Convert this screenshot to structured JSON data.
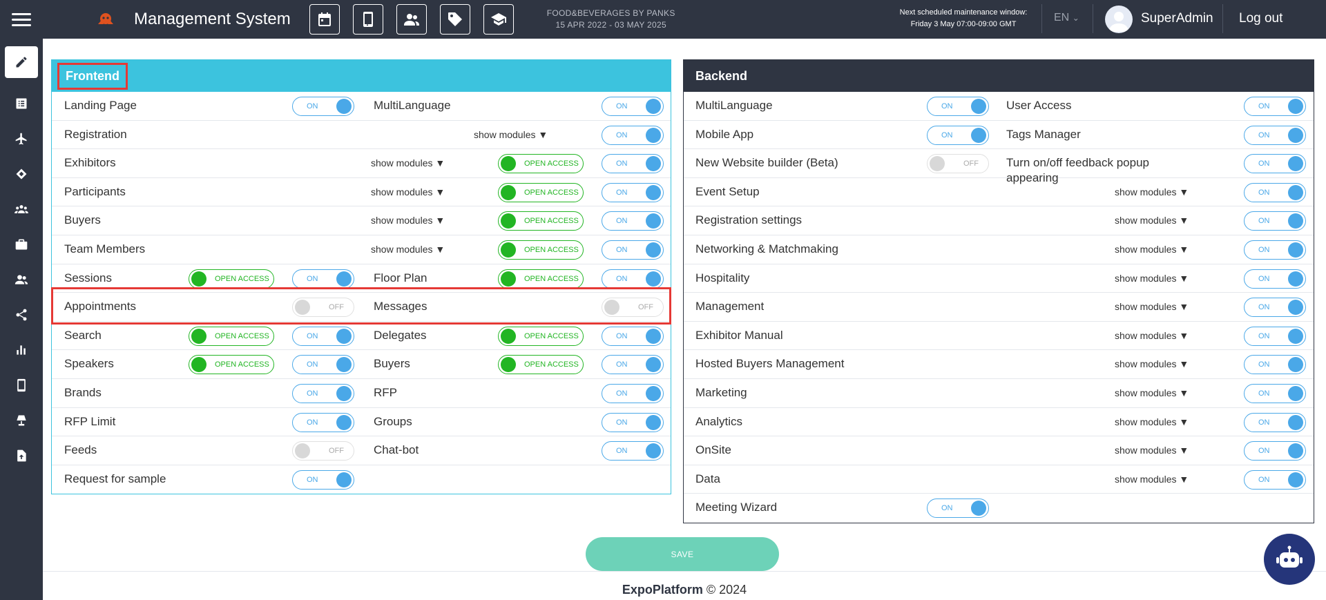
{
  "header": {
    "title": "Management System",
    "event_name": "FOOD&BEVERAGES BY PANKS",
    "event_dates": "15 APR 2022 - 03 MAY 2025",
    "maintenance_line1": "Next scheduled maintenance window:",
    "maintenance_line2": "Friday 3 May 07:00-09:00 GMT",
    "language": "EN",
    "username": "SuperAdmin",
    "logout": "Log out",
    "toolbar_icons": [
      "calendar-icon",
      "mobile-icon",
      "users-icon",
      "tag-icon",
      "graduation-cap-icon"
    ]
  },
  "sidebar": {
    "icons": [
      "pencil-icon",
      "list-icon",
      "plane-icon",
      "handshake-icon",
      "group-icon",
      "briefcase-icon",
      "users-icon",
      "share-icon",
      "bar-chart-icon",
      "mobile-icon",
      "lamp-icon",
      "file-upload-icon"
    ],
    "active_index": 0
  },
  "frontend": {
    "title": "Frontend",
    "rows": [
      {
        "left": {
          "label": "Landing Page",
          "toggle": "ON"
        },
        "right": {
          "label": "MultiLanguage",
          "toggle": "ON"
        }
      },
      {
        "left": {
          "label": "Registration"
        },
        "right": {
          "show_modules": "show modules ▼",
          "toggle": "ON"
        }
      },
      {
        "left": {
          "label": "Exhibitors",
          "show_modules": "show modules ▼"
        },
        "right": {
          "open_access": "OPEN ACCESS",
          "toggle": "ON"
        }
      },
      {
        "left": {
          "label": "Participants",
          "show_modules": "show modules ▼"
        },
        "right": {
          "open_access": "OPEN ACCESS",
          "toggle": "ON"
        }
      },
      {
        "left": {
          "label": "Buyers",
          "show_modules": "show modules ▼"
        },
        "right": {
          "open_access": "OPEN ACCESS",
          "toggle": "ON"
        }
      },
      {
        "left": {
          "label": "Team Members",
          "show_modules": "show modules ▼"
        },
        "right": {
          "open_access": "OPEN ACCESS",
          "toggle": "ON"
        }
      },
      {
        "left": {
          "label": "Sessions",
          "open_access": "OPEN ACCESS",
          "toggle": "ON"
        },
        "right": {
          "label": "Floor Plan",
          "open_access": "OPEN ACCESS",
          "toggle": "ON"
        }
      },
      {
        "left": {
          "label": "Appointments",
          "toggle": "OFF"
        },
        "right": {
          "label": "Messages",
          "toggle": "OFF"
        }
      },
      {
        "left": {
          "label": "Search",
          "open_access": "OPEN ACCESS",
          "toggle": "ON"
        },
        "right": {
          "label": "Delegates",
          "open_access": "OPEN ACCESS",
          "toggle": "ON"
        }
      },
      {
        "left": {
          "label": "Speakers",
          "open_access": "OPEN ACCESS",
          "toggle": "ON"
        },
        "right": {
          "label": "Buyers",
          "open_access": "OPEN ACCESS",
          "toggle": "ON"
        }
      },
      {
        "left": {
          "label": "Brands",
          "toggle": "ON"
        },
        "right": {
          "label": "RFP",
          "toggle": "ON"
        }
      },
      {
        "left": {
          "label": "RFP Limit",
          "toggle": "ON"
        },
        "right": {
          "label": "Groups",
          "toggle": "ON"
        }
      },
      {
        "left": {
          "label": "Feeds",
          "toggle": "OFF"
        },
        "right": {
          "label": "Chat-bot",
          "toggle": "ON"
        }
      },
      {
        "left": {
          "label": "Request for sample",
          "toggle": "ON"
        },
        "right": {}
      }
    ]
  },
  "backend": {
    "title": "Backend",
    "rows": [
      {
        "left": {
          "label": "MultiLanguage",
          "toggle": "ON"
        },
        "right": {
          "label": "User Access",
          "toggle": "ON"
        }
      },
      {
        "left": {
          "label": "Mobile App",
          "toggle": "ON"
        },
        "right": {
          "label": "Tags Manager",
          "toggle": "ON"
        }
      },
      {
        "left": {
          "label": "New Website builder (Beta)",
          "toggle": "OFF"
        },
        "right": {
          "label": "Turn on/off feedback popup appearing",
          "toggle": "ON"
        }
      },
      {
        "left": {
          "label": "Event Setup"
        },
        "right": {
          "show_modules": "show modules ▼",
          "toggle": "ON"
        }
      },
      {
        "left": {
          "label": "Registration settings"
        },
        "right": {
          "show_modules": "show modules ▼",
          "toggle": "ON"
        }
      },
      {
        "left": {
          "label": "Networking & Matchmaking"
        },
        "right": {
          "show_modules": "show modules ▼",
          "toggle": "ON"
        }
      },
      {
        "left": {
          "label": "Hospitality"
        },
        "right": {
          "show_modules": "show modules ▼",
          "toggle": "ON"
        }
      },
      {
        "left": {
          "label": "Management"
        },
        "right": {
          "show_modules": "show modules ▼",
          "toggle": "ON"
        }
      },
      {
        "left": {
          "label": "Exhibitor Manual"
        },
        "right": {
          "show_modules": "show modules ▼",
          "toggle": "ON"
        }
      },
      {
        "left": {
          "label": "Hosted Buyers Management"
        },
        "right": {
          "show_modules": "show modules ▼",
          "toggle": "ON"
        }
      },
      {
        "left": {
          "label": "Marketing"
        },
        "right": {
          "show_modules": "show modules ▼",
          "toggle": "ON"
        }
      },
      {
        "left": {
          "label": "Analytics"
        },
        "right": {
          "show_modules": "show modules ▼",
          "toggle": "ON"
        }
      },
      {
        "left": {
          "label": "OnSite"
        },
        "right": {
          "show_modules": "show modules ▼",
          "toggle": "ON"
        }
      },
      {
        "left": {
          "label": "Data"
        },
        "right": {
          "show_modules": "show modules ▼",
          "toggle": "ON"
        }
      },
      {
        "left": {
          "label": "Meeting Wizard",
          "toggle": "ON"
        },
        "right": {}
      }
    ]
  },
  "save_label": "SAVE",
  "footer": {
    "brand": "ExpoPlatform",
    "copyright": "© 2024"
  },
  "colors": {
    "accent": "#3cc3de",
    "dark": "#2f3542",
    "toggle_on": "#4aa8e8",
    "open_access": "#22b523",
    "save": "#6dd2b8",
    "highlight": "#e53935"
  }
}
